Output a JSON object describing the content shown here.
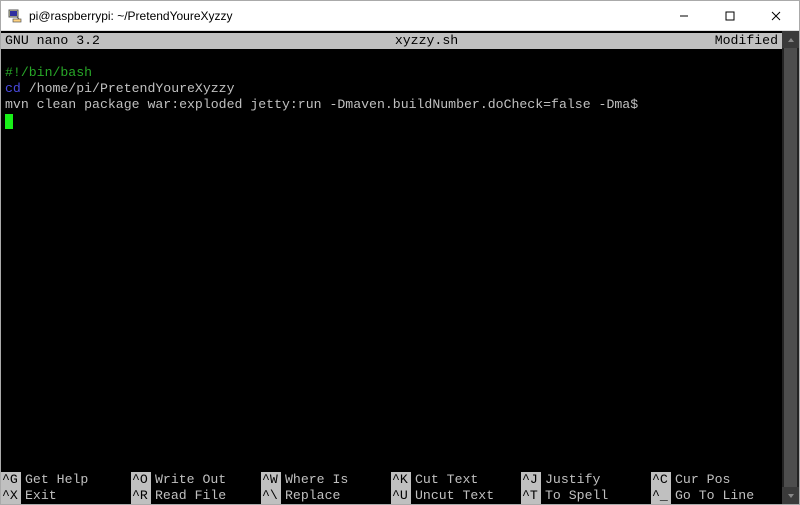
{
  "window": {
    "title": "pi@raspberrypi: ~/PretendYoureXyzzy"
  },
  "editor": {
    "program": "GNU nano 3.2",
    "filename": "xyzzy.sh",
    "status": "Modified"
  },
  "file": {
    "line1": "#!/bin/bash",
    "line2_cmd": "cd",
    "line2_args": " /home/pi/PretendYoureXyzzy",
    "line3": "mvn clean package war:exploded jetty:run -Dmaven.buildNumber.doCheck=false -Dma$"
  },
  "shortcuts": {
    "row1": [
      {
        "key": "^G",
        "label": "Get Help"
      },
      {
        "key": "^O",
        "label": "Write Out"
      },
      {
        "key": "^W",
        "label": "Where Is"
      },
      {
        "key": "^K",
        "label": "Cut Text"
      },
      {
        "key": "^J",
        "label": "Justify"
      },
      {
        "key": "^C",
        "label": "Cur Pos"
      }
    ],
    "row2": [
      {
        "key": "^X",
        "label": "Exit"
      },
      {
        "key": "^R",
        "label": "Read File"
      },
      {
        "key": "^\\",
        "label": "Replace"
      },
      {
        "key": "^U",
        "label": "Uncut Text"
      },
      {
        "key": "^T",
        "label": "To Spell"
      },
      {
        "key": "^_",
        "label": "Go To Line"
      }
    ]
  }
}
